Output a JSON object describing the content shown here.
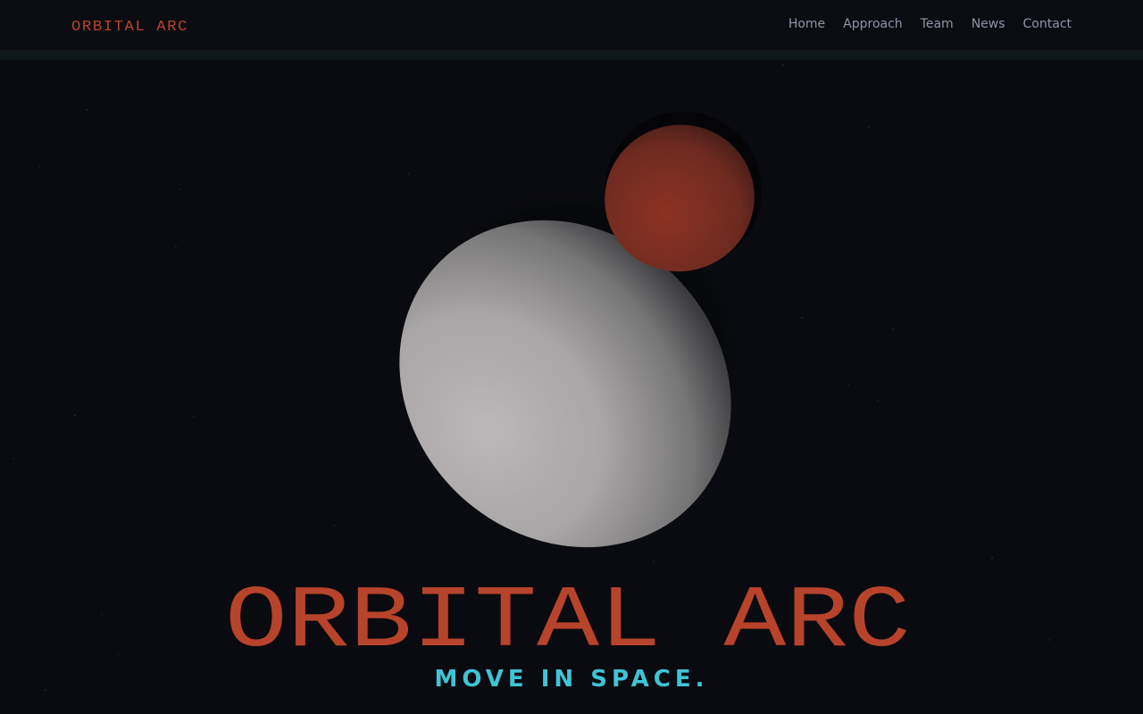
{
  "brand": {
    "logo_text": "ORBITAL ARC",
    "accent_color": "#b8432b"
  },
  "nav": {
    "items": [
      {
        "label": "Home"
      },
      {
        "label": "Approach"
      },
      {
        "label": "Team"
      },
      {
        "label": "News"
      },
      {
        "label": "Contact"
      }
    ]
  },
  "hero": {
    "title": "ORBITAL ARC",
    "tagline": "MOVE IN SPACE.",
    "tagline_color": "#3fc4d6",
    "planets": [
      {
        "name": "large-grey-planet",
        "color": "#b9b6b7"
      },
      {
        "name": "small-red-planet",
        "color": "#8a3125"
      }
    ]
  }
}
